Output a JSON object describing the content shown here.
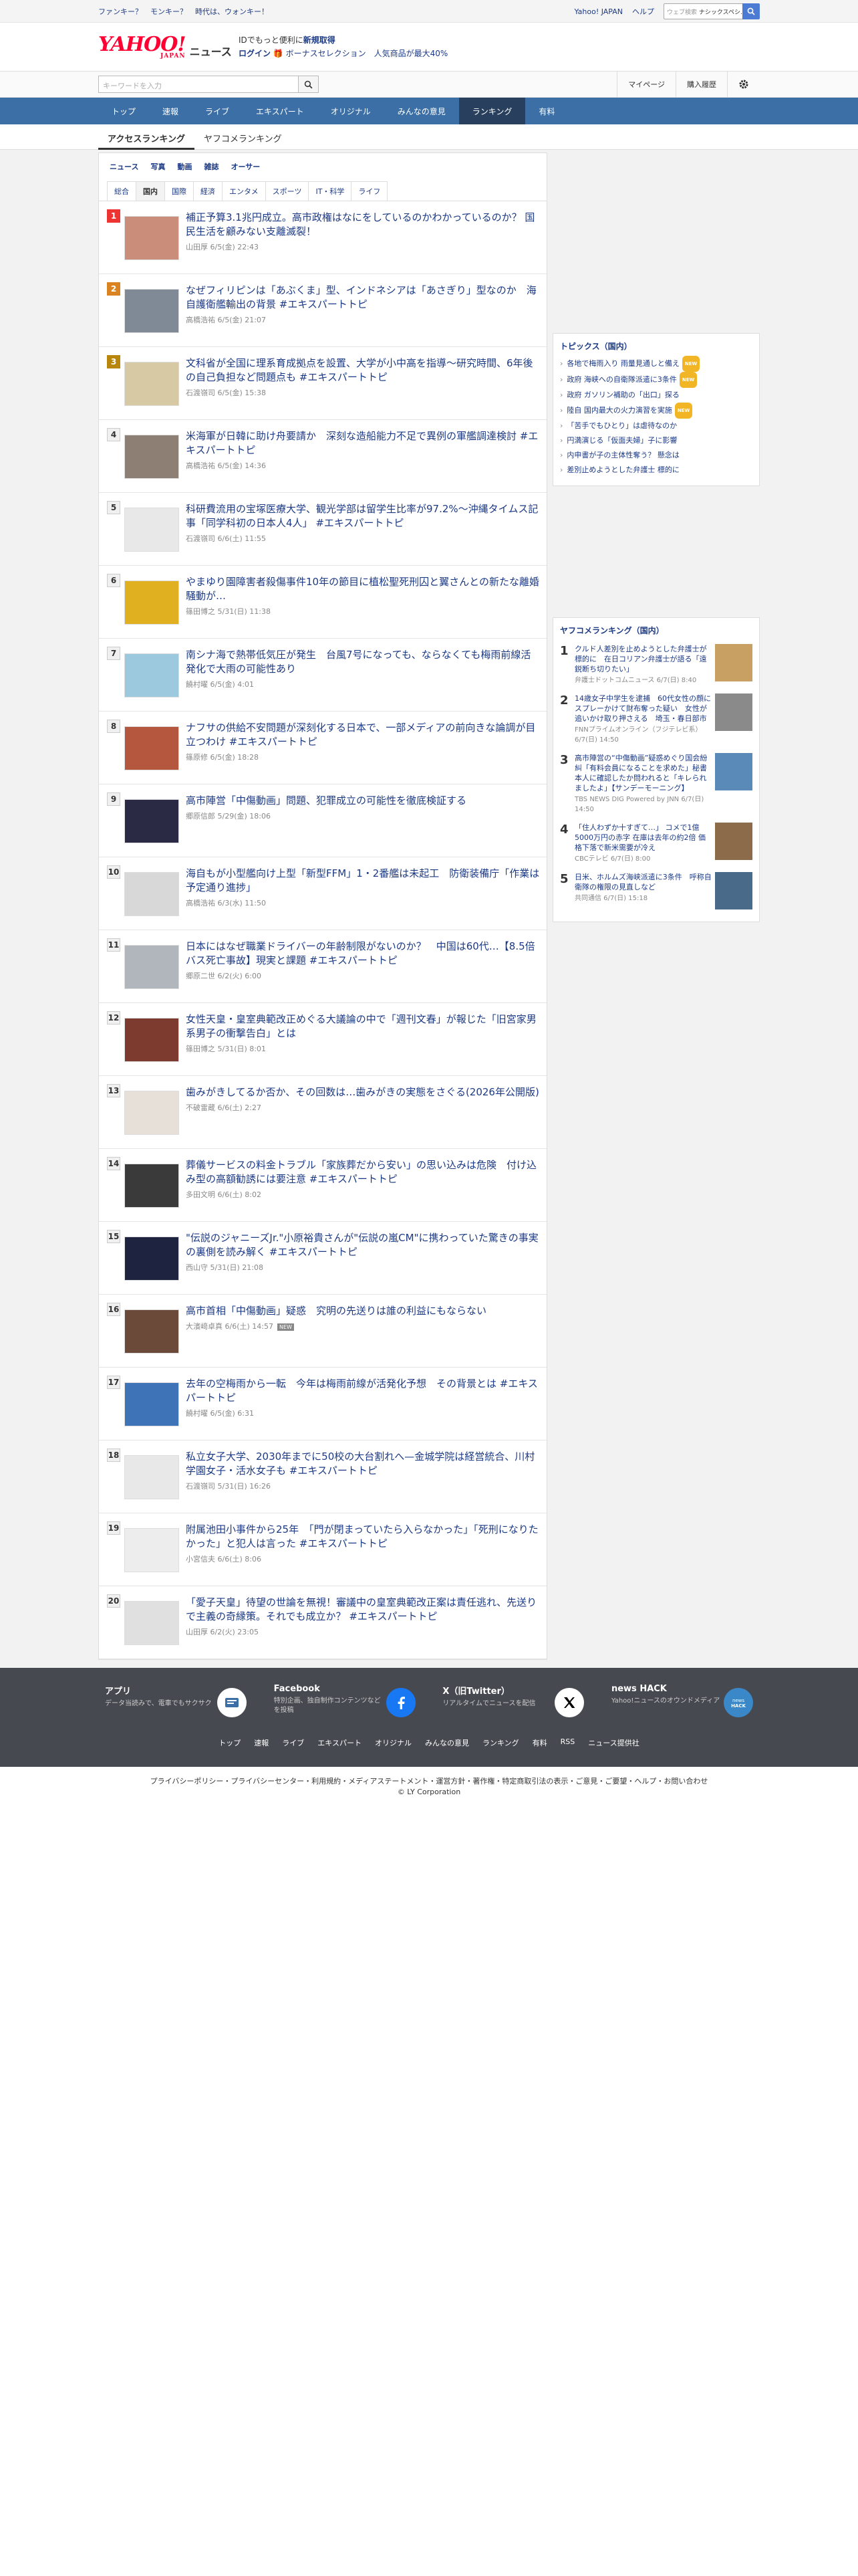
{
  "promo": [
    "ファンキー？",
    "モンキー？",
    "時代は、ウォンキー！"
  ],
  "top_links": [
    "Yahoo! JAPAN",
    "ヘルプ"
  ],
  "web_search": {
    "placeholder": "ウェブ検索",
    "value": "ナシックスペシ..."
  },
  "logo": {
    "brand": "YAHOO!",
    "sub": "JAPAN",
    "news": "ニュース"
  },
  "register": {
    "l1": "IDでもっと便利に",
    "l1b": "新規取得",
    "l2a": "ログイン",
    "l2b": "ボーナスセレクション　人気商品が最大40%"
  },
  "search": {
    "placeholder": "キーワードを入力"
  },
  "mylinks": [
    "マイページ",
    "購入履歴"
  ],
  "gnav": [
    "トップ",
    "速報",
    "ライブ",
    "エキスパート",
    "オリジナル",
    "みんなの意見",
    "ランキング",
    "有料"
  ],
  "subnav": [
    "アクセスランキング",
    "ヤフコメランキング"
  ],
  "cat1": [
    "ニュース",
    "写真",
    "動画",
    "雑誌",
    "オーサー"
  ],
  "cat2": [
    "総合",
    "国内",
    "国際",
    "経済",
    "エンタメ",
    "スポーツ",
    "IT・科学",
    "ライフ"
  ],
  "ranking": [
    {
      "rank": "1",
      "title": "補正予算3.1兆円成立。高市政権はなにをしているのかわかっているのか？ 国民生活を顧みない支離滅裂！",
      "meta": "山田厚 6/5(金) 22:43",
      "color": "#c98d7a"
    },
    {
      "rank": "2",
      "title": "なぜフィリピンは「あぶくま」型、インドネシアは「あさぎり」型なのか　海自護衛艦輸出の背景 #エキスパートトピ",
      "meta": "高橋浩祐 6/5(金) 21:07",
      "color": "#7f8a96"
    },
    {
      "rank": "3",
      "title": "文科省が全国に理系育成拠点を設置、大学が小中高を指導～研究時間、6年後の自己負担など問題点も #エキスパートトピ",
      "meta": "石渡嶺司 6/5(金) 15:38",
      "color": "#d6c9a3"
    },
    {
      "rank": "4",
      "title": "米海軍が日韓に助け舟要請か　深刻な造船能力不足で異例の軍艦調達検討 #エキスパートトピ",
      "meta": "高橋浩祐 6/5(金) 14:36",
      "color": "#8d7f73"
    },
    {
      "rank": "5",
      "title": "科研費流用の宝塚医療大学、観光学部は留学生比率が97.2%～沖縄タイムス記事「同学科初の日本人4人」 #エキスパートトピ",
      "meta": "石渡嶺司 6/6(土) 11:55",
      "color": "#e8e8e8"
    },
    {
      "rank": "6",
      "title": "やまゆり園障害者殺傷事件10年の節目に植松聖死刑囚と翼さんとの新たな離婚騒動が…",
      "meta": "篠田博之 5/31(日) 11:38",
      "color": "#e0b020"
    },
    {
      "rank": "7",
      "title": "南シナ海で熱帯低気圧が発生　台風7号になっても、ならなくても梅雨前線活発化で大雨の可能性あり",
      "meta": "饒村曜 6/5(金) 4:01",
      "color": "#9cc9de"
    },
    {
      "rank": "8",
      "title": "ナフサの供給不安問題が深刻化する日本で、一部メディアの前向きな論調が目立つわけ #エキスパートトピ",
      "meta": "篠原修 6/5(金) 18:28",
      "color": "#b5563e"
    },
    {
      "rank": "9",
      "title": "高市陣営「中傷動画」問題、犯罪成立の可能性を徹底検証する",
      "meta": "郷原信郎 5/29(金) 18:06",
      "color": "#2a2a44"
    },
    {
      "rank": "10",
      "title": "海自もが小型艦向け上型「新型FFM」1・2番艦は未起工　防衛装備庁「作業は予定通り進捗」",
      "meta": "高橋浩祐 6/3(水) 11:50",
      "color": "#d8d8d8"
    },
    {
      "rank": "11",
      "title": "日本にはなぜ職業ドライバーの年齢制限がないのか？　中国は60代…【8.5倍バス死亡事故】現実と課題 #エキスパートトピ",
      "meta": "郷原二世 6/2(火) 6:00",
      "color": "#b0b6bc"
    },
    {
      "rank": "12",
      "title": "女性天皇・皇室典範改正めぐる大議論の中で「週刊文春」が報じた「旧宮家男系男子の衝撃告白」とは",
      "meta": "篠田博之 5/31(日) 8:01",
      "color": "#7d3a2f"
    },
    {
      "rank": "13",
      "title": "歯みがきしてるか否か、その回数は…歯みがきの実態をさぐる(2026年公開版)",
      "meta": "不破雷蔵 6/6(土) 2:27",
      "color": "#e6e0d8"
    },
    {
      "rank": "14",
      "title": "葬儀サービスの料金トラブル「家族葬だから安い」の思い込みは危険　付け込み型の高額勧誘には要注意 #エキスパートトピ",
      "meta": "多田文明 6/6(土) 8:02",
      "color": "#3a3a3a"
    },
    {
      "rank": "15",
      "title": "\"伝説のジャニーズJr.\"小原裕貴さんが\"伝説の嵐CM\"に携わっていた驚きの事実の裏側を読み解く #エキスパートトピ",
      "meta": "西山守 5/31(日) 21:08",
      "color": "#1e2440"
    },
    {
      "rank": "16",
      "title": "高市首相「中傷動画」疑惑　究明の先送りは誰の利益にもならない",
      "meta": "大濱﨑卓真 6/6(土) 14:57",
      "color": "#6b4a3a",
      "badge": "NEW"
    },
    {
      "rank": "17",
      "title": "去年の空梅雨から一転　今年は梅雨前線が活発化予想　その背景とは #エキスパートトピ",
      "meta": "饒村曜 6/5(金) 6:31",
      "color": "#3f73b8"
    },
    {
      "rank": "18",
      "title": "私立女子大学、2030年までに50校の大台割れへ—金城学院は経営統合、川村学園女子・活水女子も #エキスパートトピ",
      "meta": "石渡嶺司 5/31(日) 16:26",
      "color": "#e8e8e8"
    },
    {
      "rank": "19",
      "title": "附属池田小事件から25年　「門が閉まっていたら入らなかった」「死刑になりたかった」と犯人は言った #エキスパートトピ",
      "meta": "小宮信夫 6/6(土) 8:06",
      "color": "#ededed"
    },
    {
      "rank": "20",
      "title": "「愛子天皇」待望の世論を無視！審議中の皇室典範改正案は責任逃れ、先送りで主義の奇縁策。それでも成立か？ #エキスパートトピ",
      "meta": "山田厚 6/2(火) 23:05",
      "color": "#e0e0e0"
    }
  ],
  "topics": {
    "title": "トピックス（国内）",
    "items": [
      {
        "text": "各地で梅雨入り 雨量見通しと備え",
        "new": "NEW"
      },
      {
        "text": "政府 海峡への自衛隊派遣に3条件",
        "new": "NEW"
      },
      {
        "text": "政府 ガソリン補助の「出口」探る",
        "new": ""
      },
      {
        "text": "陸自 国内最大の火力演習を実施",
        "new": "NEW"
      },
      {
        "text": "「苦手でもひとり」は虐待なのか",
        "new": ""
      },
      {
        "text": "円満演じる「仮面夫婦」子に影響",
        "new": ""
      },
      {
        "text": "内申書が子の主体性奪う？ 懸念は",
        "new": ""
      },
      {
        "text": "差別止めようとした弁護士 標的に",
        "new": ""
      }
    ]
  },
  "yahoo_comments": {
    "title": "ヤフコメランキング（国内）",
    "items": [
      {
        "rank": "1",
        "title": "クルド人差別を止めようとした弁護士が標的に　在日コリアン弁護士が語る「遠鋭断ち切りたい」",
        "src": "弁護士ドットコムニュース 6/7(日) 8:40",
        "color": "#c9a063"
      },
      {
        "rank": "2",
        "title": "14歳女子中学生を逮捕　60代女性の顔にスプレーかけて財布奪った疑い　女性が追いかけ取り押さえる　埼玉・春日部市",
        "src": "FNNプライムオンライン（フジテレビ系） 6/7(日) 14:50",
        "color": "#8a8a8a"
      },
      {
        "rank": "3",
        "title": "高市陣営の“中傷動画”疑惑めぐり国会紛糾「有料会員になることを求めた」秘書本人に確認したか問われると「キレられましたよ」【サンデーモーニング】",
        "src": "TBS NEWS DIG Powered by JNN 6/7(日) 14:50",
        "color": "#5a8ab8"
      },
      {
        "rank": "4",
        "title": "「住人わずか十すぎて…」 コメで1億5000万円の赤字 在庫は去年の約2倍 価格下落で新米需要が冷え",
        "src": "CBCテレビ 6/7(日) 8:00",
        "color": "#8b6b4a"
      },
      {
        "rank": "5",
        "title": "日米、ホルムズ海峡派遣に3条件　呼称自衛隊の権限の見直しなど",
        "src": "共同通信 6/7(日) 15:18",
        "color": "#4a6a8a"
      }
    ]
  },
  "footer": {
    "cards": [
      {
        "title": "アプリ",
        "desc": "データ当読みで、電車でもサクサク",
        "icon": "app-icon"
      },
      {
        "title": "Facebook",
        "desc": "特別企画、独自制作コンテンツなどを投稿",
        "icon": "facebook-icon"
      },
      {
        "title": "X（旧Twitter）",
        "desc": "リアルタイムでニュースを配信",
        "icon": "x-icon"
      },
      {
        "title": "news HACK",
        "desc": "Yahoo!ニュースのオウンドメディア",
        "icon": "newshack-icon"
      }
    ],
    "links": [
      "トップ",
      "速報",
      "ライブ",
      "エキスパート",
      "オリジナル",
      "みんなの意見",
      "ランキング",
      "有料",
      "RSS",
      "ニュース提供社"
    ],
    "legal": "プライバシーポリシー・プライバシーセンター・利用規約・メディアステートメント・運営方針・著作権・特定商取引法の表示・ご意見・ご要望・ヘルプ・お問い合わせ",
    "copyright": "© LY Corporation"
  },
  "colors": {
    "nav": "#3b6fa6",
    "nav_active": "#283f5e",
    "link": "#1c3a84",
    "rank1": "#e33",
    "rank2": "#d98323",
    "rank3": "#b8860b",
    "footer": "#464a50"
  }
}
